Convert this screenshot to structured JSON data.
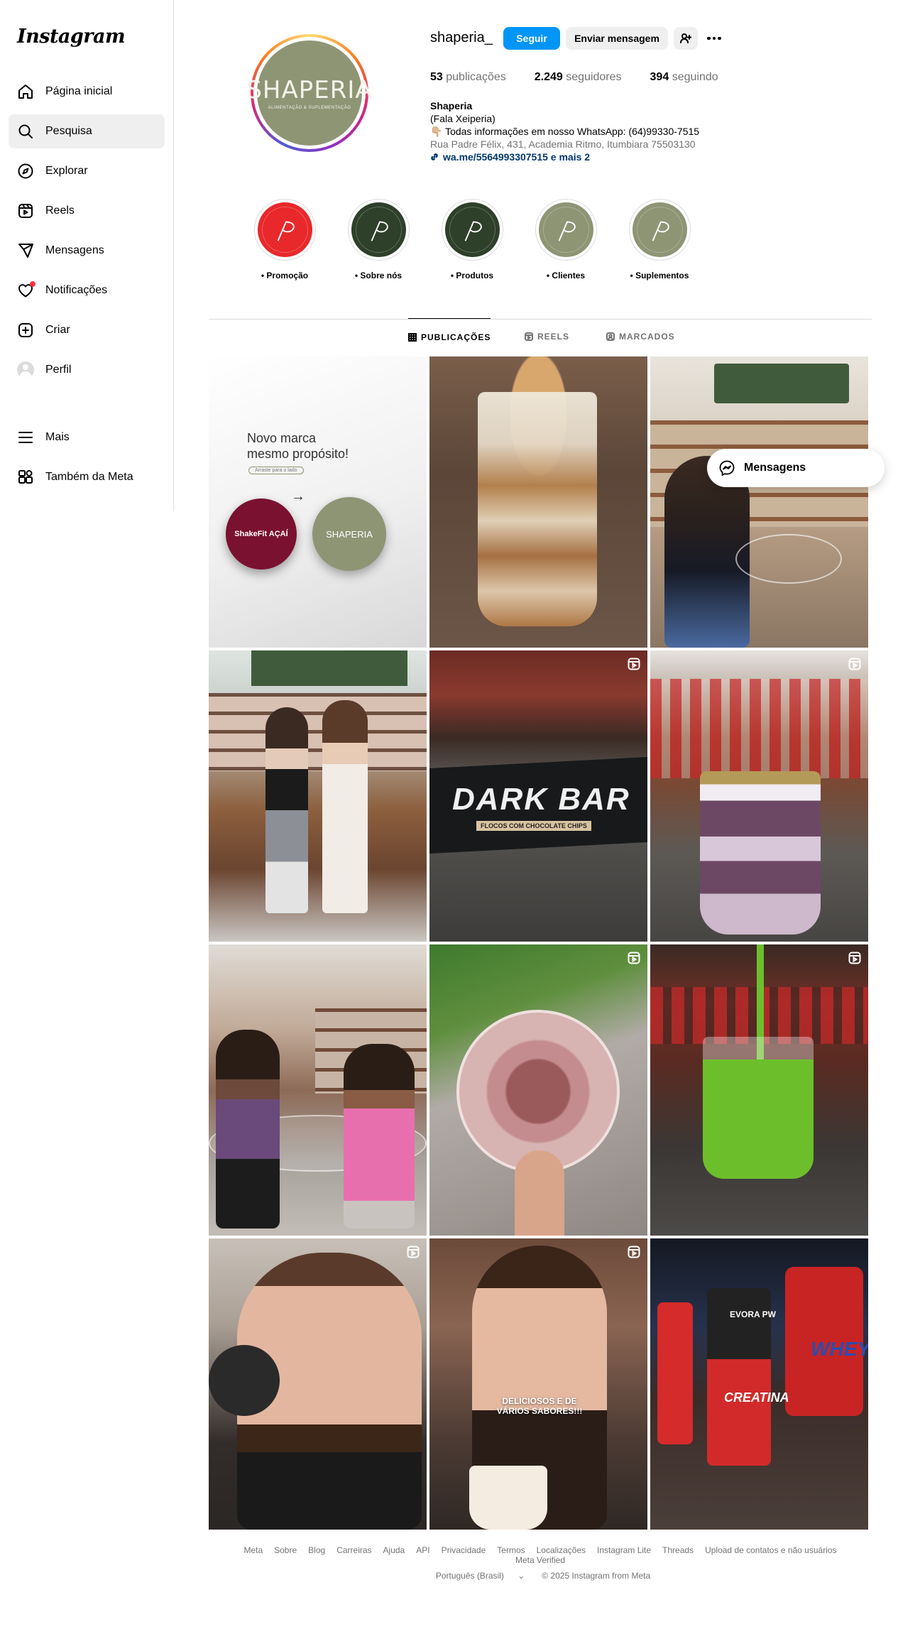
{
  "app": {
    "logo_text": "Instagram"
  },
  "sidebar": {
    "items": [
      {
        "label": "Página inicial",
        "icon": "home-icon"
      },
      {
        "label": "Pesquisa",
        "icon": "search-icon"
      },
      {
        "label": "Explorar",
        "icon": "compass-icon"
      },
      {
        "label": "Reels",
        "icon": "reels-icon"
      },
      {
        "label": "Mensagens",
        "icon": "send-icon"
      },
      {
        "label": "Notificações",
        "icon": "heart-icon"
      },
      {
        "label": "Criar",
        "icon": "plus-square-icon"
      },
      {
        "label": "Perfil",
        "icon": "avatar"
      }
    ],
    "more": {
      "label": "Mais",
      "icon": "menu-icon"
    },
    "meta": {
      "label": "Também da Meta",
      "icon": "meta-apps-icon"
    },
    "active_item": "Pesquisa"
  },
  "profile": {
    "avatar_brand": "SHAPERIA",
    "avatar_tagline": "ALIMENTAÇÃO & SUPLEMENTAÇÃO",
    "username": "shaperia_",
    "follow_label": "Seguir",
    "message_label": "Enviar mensagem",
    "stats": {
      "posts_count": "53",
      "posts_label": "publicações",
      "followers_count": "2.249",
      "followers_label": "seguidores",
      "following_count": "394",
      "following_label": "seguindo"
    },
    "bio": {
      "name": "Shaperia",
      "subtitle": "(Fala Xeiperia)",
      "line1": "👇🏼 Todas informações em nosso WhatsApp: (64)99330-7515",
      "address": "Rua Padre Félix, 431, Academia Ritmo, Itumbiara 75503130",
      "link": "wa.me/5564993307515 e mais 2"
    }
  },
  "highlights": [
    {
      "label": "• Promoção",
      "color": "#e8282b"
    },
    {
      "label": "• Sobre nós",
      "color": "#2e3f2a"
    },
    {
      "label": "• Produtos",
      "color": "#2e3f2a"
    },
    {
      "label": "• Clientes",
      "color": "#8e9575"
    },
    {
      "label": "• Suplementos",
      "color": "#8e9575"
    }
  ],
  "tabs": [
    {
      "label": "PUBLICAÇÕES",
      "active": true
    },
    {
      "label": "REELS",
      "active": false
    },
    {
      "label": "MARCADOS",
      "active": false
    }
  ],
  "posts": [
    {
      "type": "image",
      "text": {
        "line1": "Novo marca",
        "line2": "mesmo propósito!",
        "small": "Arraste para o lado",
        "badge1": "ShakeFit AÇAÍ",
        "badge2": "SHAPERIA"
      }
    },
    {
      "type": "image"
    },
    {
      "type": "image"
    },
    {
      "type": "image"
    },
    {
      "type": "reel",
      "text": {
        "product": "DARK BAR",
        "sub": "FLOCOS COM CHOCOLATE CHIPS"
      }
    },
    {
      "type": "reel"
    },
    {
      "type": "image"
    },
    {
      "type": "reel"
    },
    {
      "type": "reel"
    },
    {
      "type": "reel"
    },
    {
      "type": "reel",
      "text": {
        "caption": "DELICIOSOS E DE VÁRIOS SABORES!!!"
      }
    },
    {
      "type": "image",
      "text": {
        "brand1": "WHEY",
        "brand2": "CREATINA",
        "brand3": "EVORA PW"
      }
    }
  ],
  "messages_pill": {
    "label": "Mensagens"
  },
  "footer": {
    "links": [
      "Meta",
      "Sobre",
      "Blog",
      "Carreiras",
      "Ajuda",
      "API",
      "Privacidade",
      "Termos",
      "Localizações",
      "Instagram Lite",
      "Threads",
      "Upload de contatos e não usuários",
      "Meta Verified"
    ],
    "language": "Português (Brasil)",
    "copyright": "© 2025 Instagram from Meta"
  }
}
